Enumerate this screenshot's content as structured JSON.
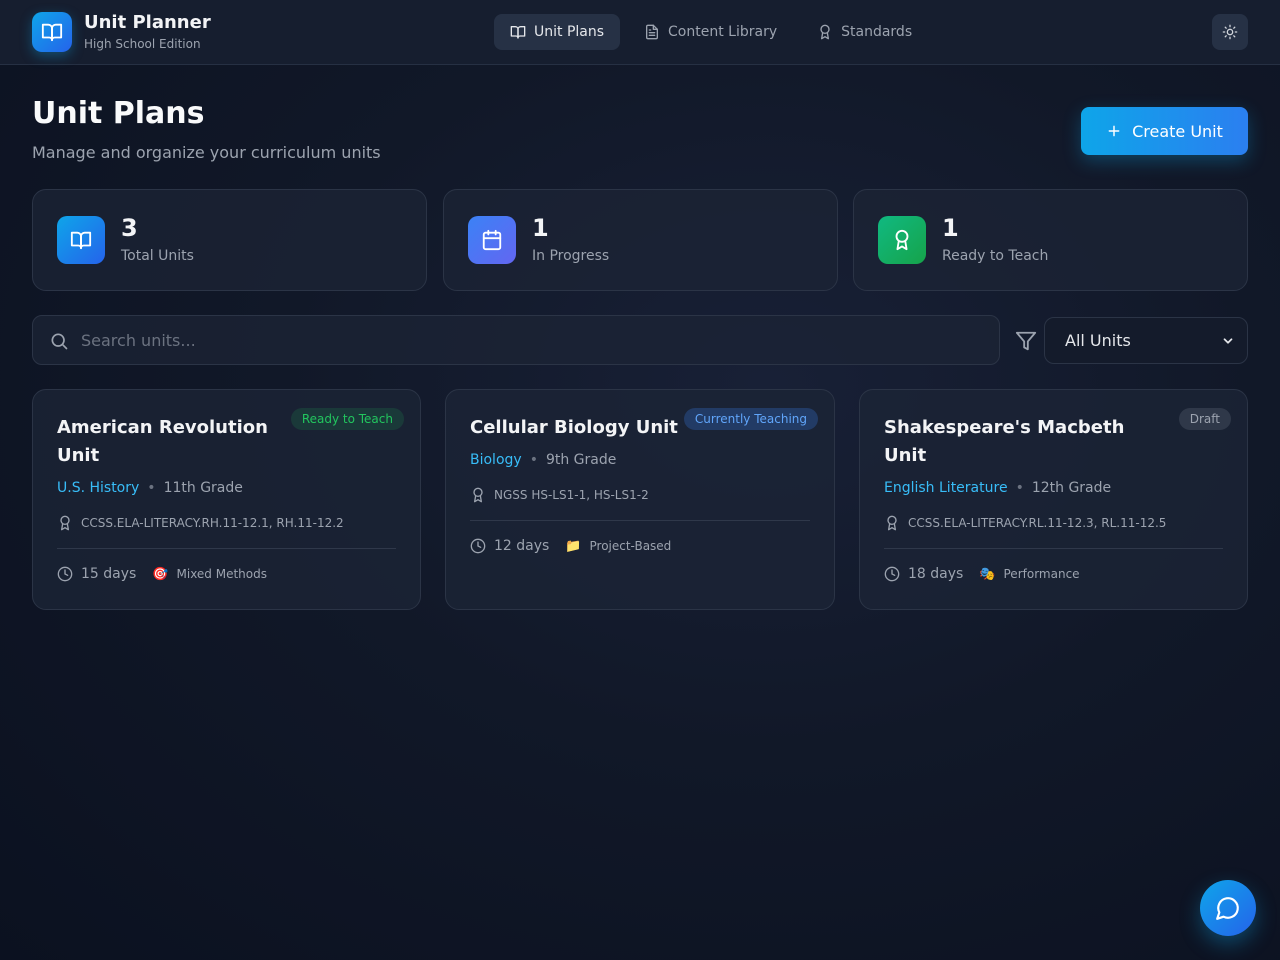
{
  "brand": {
    "title": "Unit Planner",
    "subtitle": "High School Edition",
    "logo_icon": "open-book-icon"
  },
  "nav": [
    {
      "label": "Unit Plans",
      "icon": "open-book-icon",
      "active": true
    },
    {
      "label": "Content Library",
      "icon": "document-icon",
      "active": false
    },
    {
      "label": "Standards",
      "icon": "award-icon",
      "active": false
    }
  ],
  "theme_toggle": {
    "icon": "sun-icon"
  },
  "header": {
    "title": "Unit Plans",
    "subtitle": "Manage and organize your curriculum units",
    "create_label": "Create Unit"
  },
  "stats": [
    {
      "value": "3",
      "label": "Total Units",
      "icon": "open-book-icon",
      "color": "#0ea5e9"
    },
    {
      "value": "1",
      "label": "In Progress",
      "icon": "calendar-icon",
      "color": "#4f6ef0"
    },
    {
      "value": "1",
      "label": "Ready to Teach",
      "icon": "award-icon",
      "color": "#10b981"
    }
  ],
  "search": {
    "placeholder": "Search units...",
    "value": ""
  },
  "filter": {
    "selected": "All Units"
  },
  "units": [
    {
      "title": "American Revolution Unit",
      "status": "Ready to Teach",
      "status_color": "#22c55e",
      "subject": "U.S. History",
      "grade": "11th Grade",
      "standards": "CCSS.ELA-LITERACY.RH.11-12.1, RH.11-12.2",
      "duration": "15 days",
      "method_icon": "🎯",
      "method": "Mixed Methods"
    },
    {
      "title": "Cellular Biology Unit",
      "status": "Currently Teaching",
      "status_color": "#60a5fa",
      "subject": "Biology",
      "grade": "9th Grade",
      "standards": "NGSS HS-LS1-1, HS-LS1-2",
      "duration": "12 days",
      "method_icon": "📁",
      "method": "Project-Based"
    },
    {
      "title": "Shakespeare's Macbeth Unit",
      "status": "Draft",
      "status_color": "#9ca3af",
      "subject": "English Literature",
      "grade": "12th Grade",
      "standards": "CCSS.ELA-LITERACY.RL.11-12.3, RL.11-12.5",
      "duration": "18 days",
      "method_icon": "🎭",
      "method": "Performance"
    }
  ],
  "chat": {
    "icon": "chat-bubble-icon"
  }
}
